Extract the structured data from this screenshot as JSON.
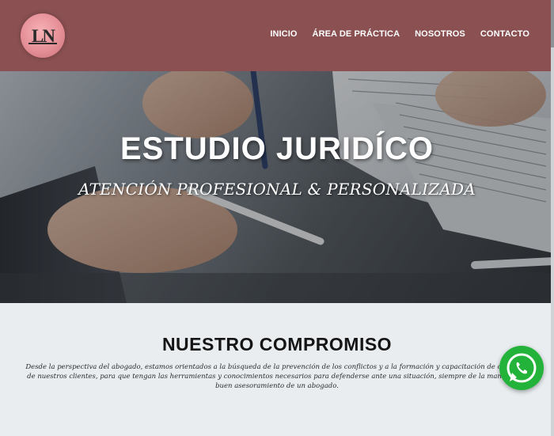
{
  "brand": {
    "logo_text": "LN",
    "color": "#8a5052"
  },
  "nav": {
    "items": [
      {
        "label": "INICIO"
      },
      {
        "label": "ÁREA DE PRÁCTICA"
      },
      {
        "label": "NOSOTROS"
      },
      {
        "label": "CONTACTO"
      }
    ]
  },
  "hero": {
    "title": "ESTUDIO JURIDÍCO",
    "subtitle": "ATENCIÓN PROFESIONAL & PERSONALIZADA"
  },
  "commitment": {
    "title": "NUESTRO COMPROMISO",
    "text": "Desde la perspectiva del abogado, estamos orientados a la búsqueda de la prevención de los conflictos y a la formación y capacitación de cada uno de nuestros clientes, para que tengan las herramientas y conocimientos necesarios para defenderse ante una situación, siempre de la mano de un buen asesoramiento de un abogado."
  },
  "whatsapp": {
    "icon": "whatsapp-icon",
    "color": "#23b33a"
  }
}
